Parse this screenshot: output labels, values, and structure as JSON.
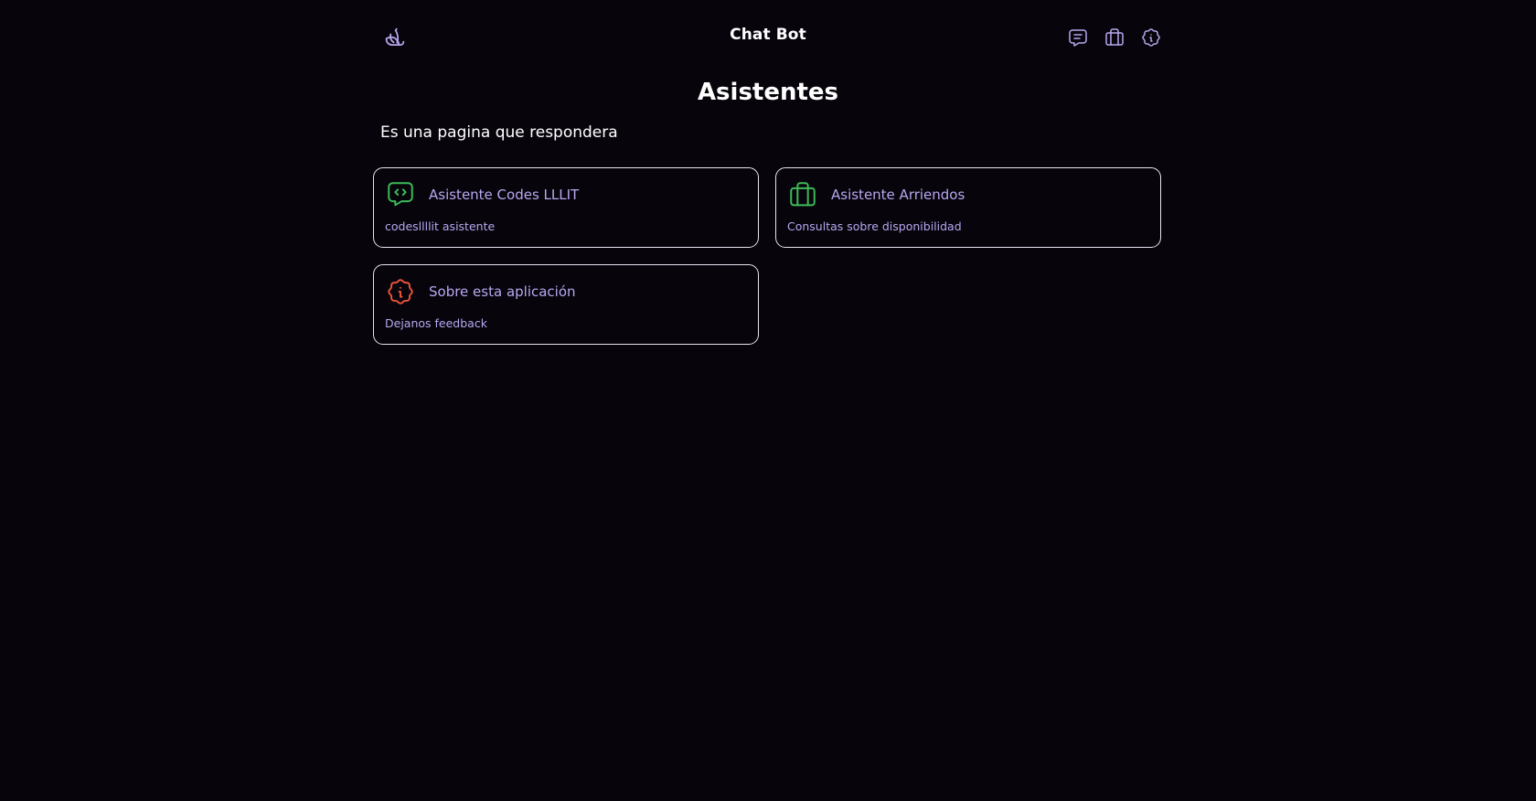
{
  "colors": {
    "background": "#07040c",
    "accent_purple": "#b9a8f0",
    "icon_green": "#3dba58",
    "icon_red": "#e8533a",
    "card_border": "#e8e4f0"
  },
  "navbar": {
    "logo_icon": "banana-logo-icon",
    "title": "Chat Bot",
    "icons": [
      "message-code-icon",
      "briefcase-icon",
      "info-badge-icon"
    ]
  },
  "main": {
    "title": "Asistentes",
    "subtitle": "Es una pagina que respondera",
    "cards": [
      {
        "icon": "message-code-icon",
        "title": "Asistente Codes LLLIT",
        "description": "codesllllit asistente"
      },
      {
        "icon": "briefcase-icon",
        "title": "Asistente Arriendos",
        "description": "Consultas sobre disponibilidad"
      },
      {
        "icon": "info-badge-icon",
        "title": "Sobre esta aplicación",
        "description": "Dejanos feedback"
      }
    ]
  }
}
